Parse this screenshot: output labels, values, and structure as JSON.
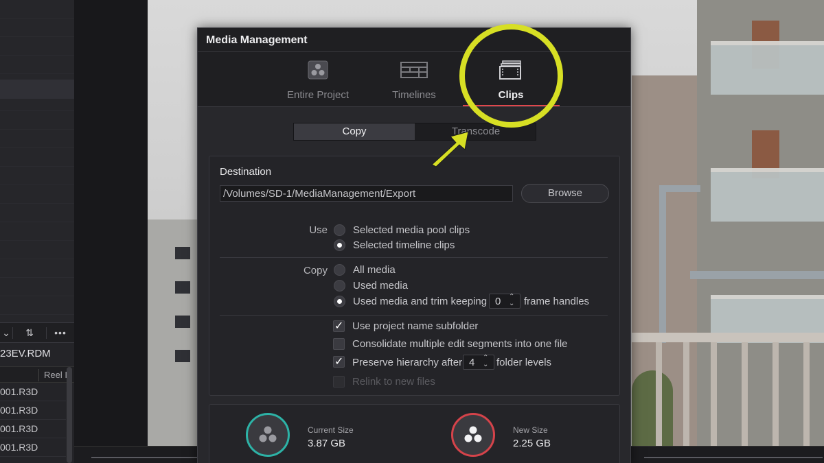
{
  "left_panel": {
    "bin_name": "23EV.RDM",
    "column_header": "Reel I",
    "files": [
      "001.R3D",
      "001.R3D",
      "001.R3D",
      "001.R3D"
    ],
    "toolbar_icons": [
      "chevron-down-icon",
      "sort-icon",
      "more-icon"
    ]
  },
  "dialog": {
    "title": "Media Management",
    "tabs": [
      {
        "label": "Entire Project",
        "icon": "project-icon",
        "active": false
      },
      {
        "label": "Timelines",
        "icon": "timeline-icon",
        "active": false
      },
      {
        "label": "Clips",
        "icon": "clips-icon",
        "active": true
      }
    ],
    "mode_segments": {
      "copy": "Copy",
      "transcode": "Transcode",
      "selected": "Copy"
    },
    "destination": {
      "label": "Destination",
      "path": "/Volumes/SD-1/MediaManagement/Export",
      "browse_label": "Browse"
    },
    "use": {
      "label": "Use",
      "options": [
        "Selected media pool clips",
        "Selected timeline clips"
      ],
      "selected_index": 1
    },
    "copy": {
      "label": "Copy",
      "options": [
        "All media",
        "Used media",
        "Used media and trim keeping"
      ],
      "selected_index": 2,
      "frame_handles_value": "0",
      "frame_handles_suffix": "frame handles"
    },
    "checkboxes": {
      "project_subfolder": {
        "label": "Use project name subfolder",
        "checked": true
      },
      "consolidate": {
        "label": "Consolidate multiple edit segments into one file",
        "checked": false
      },
      "preserve": {
        "label": "Preserve hierarchy after",
        "checked": true,
        "value": "4",
        "suffix": "folder levels"
      },
      "relink": {
        "label": "Relink to new files",
        "checked": false,
        "disabled": true
      }
    },
    "sizes": {
      "current_label": "Current Size",
      "current_value": "3.87 GB",
      "new_label": "New Size",
      "new_value": "2.25 GB"
    }
  },
  "colors": {
    "annotation": "#d7df24",
    "active_tab_underline": "#e0474c",
    "current_ring": "#2db3a7",
    "new_ring": "#d5434a"
  }
}
